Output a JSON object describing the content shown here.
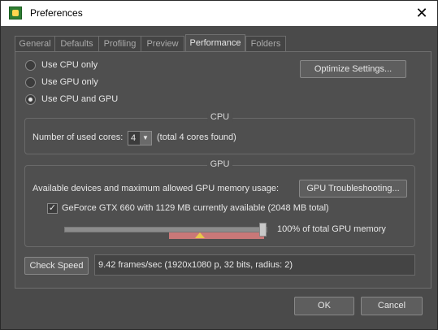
{
  "window": {
    "title": "Preferences",
    "close_glyph": "✕"
  },
  "tabs": [
    {
      "label": "General",
      "active": false
    },
    {
      "label": "Defaults",
      "active": false
    },
    {
      "label": "Profiling",
      "active": false
    },
    {
      "label": "Preview",
      "active": false
    },
    {
      "label": "Performance",
      "active": true
    },
    {
      "label": "Folders",
      "active": false
    }
  ],
  "performance": {
    "mode_options": [
      {
        "label": "Use CPU only",
        "checked": false
      },
      {
        "label": "Use GPU only",
        "checked": false
      },
      {
        "label": "Use CPU and GPU",
        "checked": true
      }
    ],
    "optimize_button": "Optimize Settings...",
    "cpu": {
      "group_title": "CPU",
      "cores_label": "Number of used cores:",
      "cores_value": "4",
      "cores_total": "(total 4 cores found)"
    },
    "gpu": {
      "group_title": "GPU",
      "devices_label": "Available devices and maximum allowed GPU memory usage:",
      "troubleshoot_button": "GPU Troubleshooting...",
      "device": {
        "checked": true,
        "label": "GeForce GTX 660 with 1129 MB currently available (2048 MB total)"
      },
      "memory_percent": 100,
      "memory_label": "100%  of total GPU memory"
    },
    "check_speed_button": "Check Speed",
    "speed_readout": "9.42 frames/sec (1920x1080 p, 32 bits, radius: 2)"
  },
  "footer": {
    "ok_button": "OK",
    "cancel_button": "Cancel"
  },
  "icons": {
    "app": "app-icon",
    "radio_checked": "radio-checked",
    "checkbox_check": "✓",
    "dropdown_arrow": "▼"
  },
  "colors": {
    "window_bg": "#4a4a4a",
    "panel_bg": "#4f4f4f",
    "text": "#e6e6e6",
    "slider_range": "#c97878",
    "marker": "#e8c84a"
  }
}
